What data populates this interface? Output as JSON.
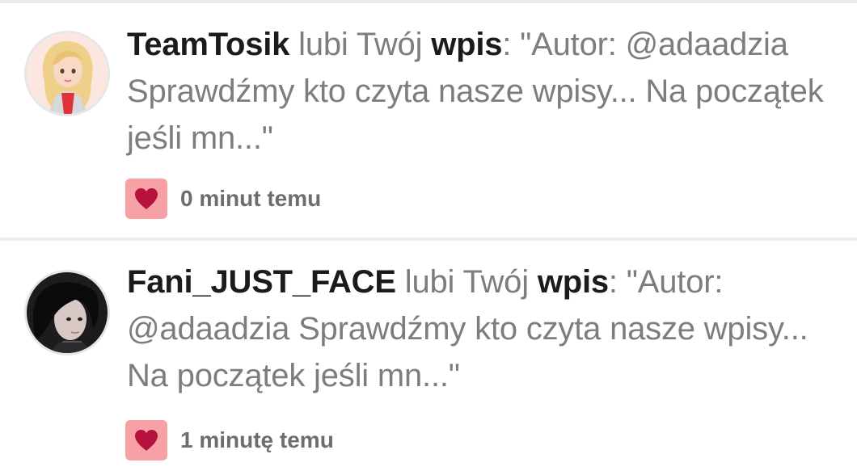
{
  "notifications": [
    {
      "username": "TeamTosik",
      "action": "lubi Twój",
      "object": "wpis",
      "quote_line1": "\"Autor:",
      "quote_rest": "@adaadzia Sprawdźmy kto czyta nasze wpisy... Na początek jeśli mn...\"",
      "time": "0 minut temu",
      "icon": "heart-icon",
      "heart_bg": "#f7a1a7",
      "heart_color": "#b5123d"
    },
    {
      "username": "Fani_JUST_FACE",
      "action": "lubi Twój",
      "object": "wpis",
      "quote_line1": "\"Autor:",
      "quote_rest": "@adaadzia Sprawdźmy kto czyta nasze wpisy... Na początek jeśli mn...\"",
      "time": "1 minutę temu",
      "icon": "heart-icon",
      "heart_bg": "#f7a1a7",
      "heart_color": "#b5123d"
    }
  ]
}
